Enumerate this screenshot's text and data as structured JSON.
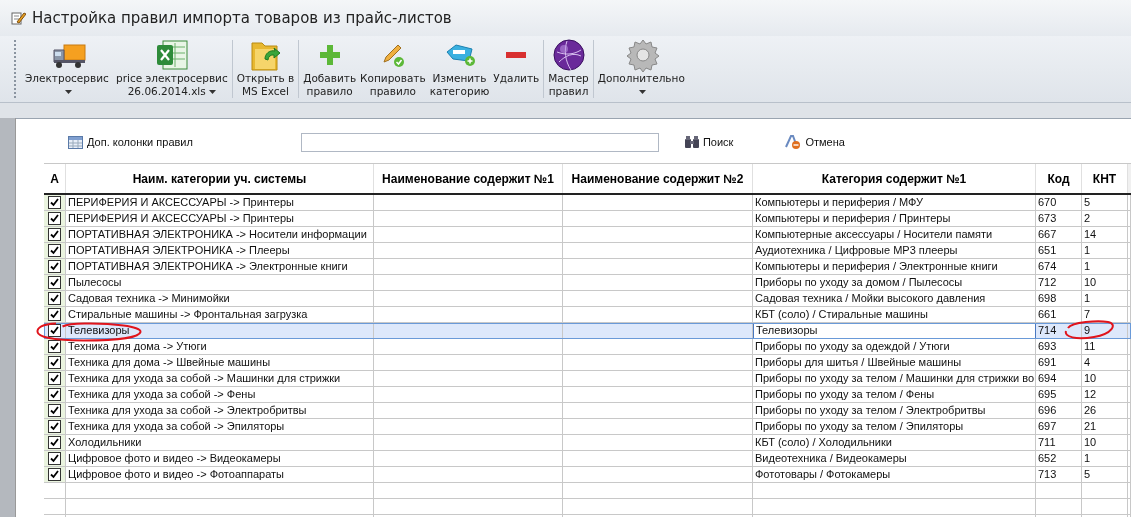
{
  "window": {
    "title": "Настройка правил импорта товаров из прайс-листов"
  },
  "toolbar": [
    [
      {
        "kind": "truck",
        "label": "Электросервис",
        "dropdown": true
      },
      {
        "kind": "spreadsheet",
        "label": "price электросервис\n26.06.2014.xls",
        "dropdown": true
      }
    ],
    [
      {
        "kind": "folder",
        "label": "Открыть в\nMS Excel",
        "dropdown": false
      }
    ],
    [
      {
        "kind": "plus",
        "label": "Добавить\nправило",
        "dropdown": false
      },
      {
        "kind": "pencil",
        "label": "Копировать\nправило",
        "dropdown": false
      },
      {
        "kind": "tag",
        "label": "Изменить\nкатегорию",
        "dropdown": false
      },
      {
        "kind": "minus",
        "label": "Удалить",
        "dropdown": false
      }
    ],
    [
      {
        "kind": "sphere",
        "label": "Мастер\nправил",
        "dropdown": false
      }
    ],
    [
      {
        "kind": "gear",
        "label": "Дополнительно",
        "dropdown": true
      }
    ]
  ],
  "filter_bar": {
    "columns_button": "Доп. колонки правил",
    "search_button": "Поиск",
    "cancel_button": "Отмена"
  },
  "table": {
    "columns": [
      "А",
      "Наим. категории уч. системы",
      "Наименование содержит №1",
      "Наименование содержит №2",
      "Категория содержит №1",
      "Код",
      "КНТ"
    ],
    "rows": [
      {
        "checked": true,
        "selected": false,
        "circled": false,
        "name": "ПЕРИФЕРИЯ И АКСЕССУАРЫ -> Принтеры",
        "category": "Компьютеры и периферия / МФУ",
        "code": "670",
        "knt": "5"
      },
      {
        "checked": true,
        "selected": false,
        "circled": false,
        "name": "ПЕРИФЕРИЯ И АКСЕССУАРЫ -> Принтеры",
        "category": "Компьютеры и периферия / Принтеры",
        "code": "673",
        "knt": "2"
      },
      {
        "checked": true,
        "selected": false,
        "circled": false,
        "name": "ПОРТАТИВНАЯ ЭЛЕКТРОНИКА -> Носители информации",
        "category": "Компьютерные аксессуары / Носители памяти",
        "code": "667",
        "knt": "14"
      },
      {
        "checked": true,
        "selected": false,
        "circled": false,
        "name": "ПОРТАТИВНАЯ ЭЛЕКТРОНИКА -> Плееры",
        "category": "Аудиотехника / Цифровые MP3 плееры",
        "code": "651",
        "knt": "1"
      },
      {
        "checked": true,
        "selected": false,
        "circled": false,
        "name": "ПОРТАТИВНАЯ ЭЛЕКТРОНИКА -> Электронные книги",
        "category": "Компьютеры и периферия / Электронные книги",
        "code": "674",
        "knt": "1"
      },
      {
        "checked": true,
        "selected": false,
        "circled": false,
        "name": "Пылесосы",
        "category": "Приборы по уходу за домом / Пылесосы",
        "code": "712",
        "knt": "10"
      },
      {
        "checked": true,
        "selected": false,
        "circled": false,
        "name": "Садовая техника -> Минимойки",
        "category": "Садовая техника / Мойки высокого давления",
        "code": "698",
        "knt": "1"
      },
      {
        "checked": true,
        "selected": false,
        "circled": false,
        "name": "Стиральные машины -> Фронтальная загрузка",
        "category": "КБТ (соло) / Стиральные машины",
        "code": "661",
        "knt": "7"
      },
      {
        "checked": true,
        "selected": true,
        "circled": true,
        "name": "Телевизоры",
        "category": "Телевизоры",
        "code": "714",
        "knt": "9"
      },
      {
        "checked": true,
        "selected": false,
        "circled": false,
        "name": "Техника для дома -> Утюги",
        "category": "Приборы по уходу за одеждой / Утюги",
        "code": "693",
        "knt": "11"
      },
      {
        "checked": true,
        "selected": false,
        "circled": false,
        "name": "Техника для дома -> Швейные машины",
        "category": "Приборы для шитья / Швейные машины",
        "code": "691",
        "knt": "4"
      },
      {
        "checked": true,
        "selected": false,
        "circled": false,
        "name": "Техника для ухода за собой -> Машинки для стрижки",
        "category": "Приборы по уходу за телом / Машинки для стрижки во",
        "code": "694",
        "knt": "10"
      },
      {
        "checked": true,
        "selected": false,
        "circled": false,
        "name": "Техника для ухода за собой -> Фены",
        "category": "Приборы по уходу за телом / Фены",
        "code": "695",
        "knt": "12"
      },
      {
        "checked": true,
        "selected": false,
        "circled": false,
        "name": "Техника для ухода за собой -> Электробритвы",
        "category": "Приборы по уходу за телом / Электробритвы",
        "code": "696",
        "knt": "26"
      },
      {
        "checked": true,
        "selected": false,
        "circled": false,
        "name": "Техника для ухода за собой -> Эпиляторы",
        "category": "Приборы по уходу за телом / Эпиляторы",
        "code": "697",
        "knt": "21"
      },
      {
        "checked": true,
        "selected": false,
        "circled": false,
        "name": "Холодильники",
        "category": "КБТ (соло) / Холодильники",
        "code": "711",
        "knt": "10"
      },
      {
        "checked": true,
        "selected": false,
        "circled": false,
        "name": "Цифровое фото и видео -> Видеокамеры",
        "category": "Видеотехника / Видеокамеры",
        "code": "652",
        "knt": "1"
      },
      {
        "checked": true,
        "selected": false,
        "circled": false,
        "name": "Цифровое фото и видео -> Фотоаппараты",
        "category": "Фототовары / Фотокамеры",
        "code": "713",
        "knt": "5"
      }
    ]
  }
}
